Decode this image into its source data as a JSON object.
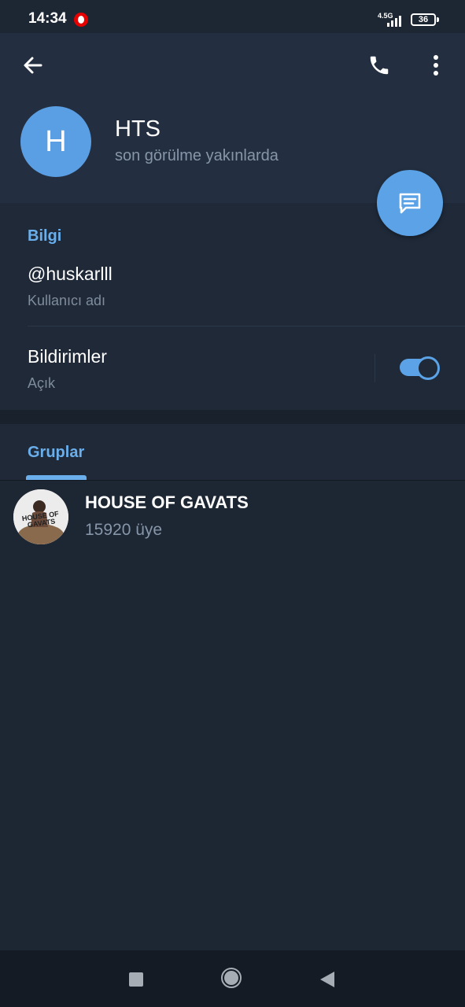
{
  "status_bar": {
    "time": "14:34",
    "network": "4.5G",
    "battery": "36"
  },
  "header": {
    "avatar_initial": "H",
    "name": "HTS",
    "status": "son görülme yakınlarda",
    "icons": [
      "back-arrow-icon",
      "phone-icon",
      "more-vertical-icon",
      "message-icon"
    ],
    "accent_color": "#5ba2e6"
  },
  "info": {
    "section_title": "Bilgi",
    "username": "@huskarlll",
    "username_label": "Kullanıcı adı",
    "notifications_title": "Bildirimler",
    "notifications_state": "Açık",
    "notifications_enabled": true
  },
  "groups": {
    "tab_label": "Gruplar",
    "items": [
      {
        "name": "HOUSE OF GAVATS",
        "members": "15920 üye",
        "avatar_text": "HOUSE OF GAVATS"
      }
    ]
  },
  "nav": {
    "icons": [
      "recents-square-icon",
      "home-circle-icon",
      "back-triangle-icon"
    ]
  }
}
